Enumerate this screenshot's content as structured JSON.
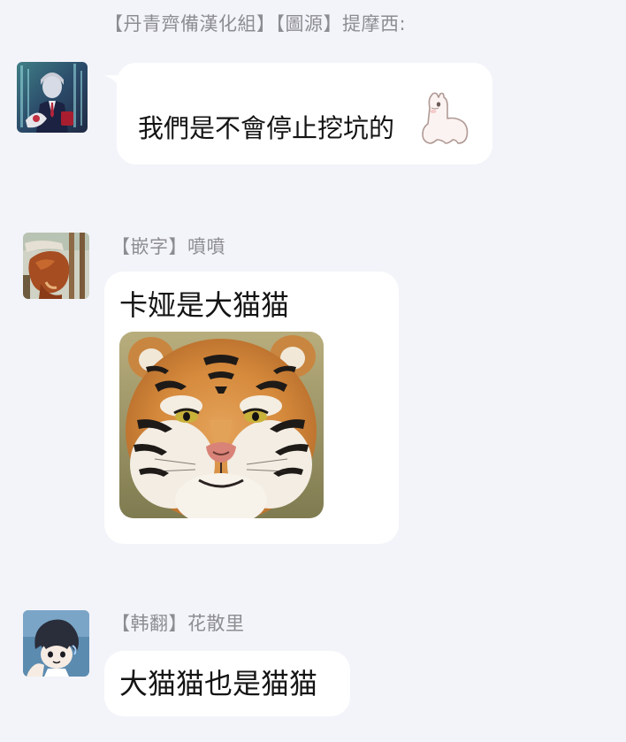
{
  "chat": {
    "messages": [
      {
        "sender": "【丹青齊備漢化組】【圖源】提摩西:",
        "text": "我們是不會停止挖坑的",
        "sticker_icon": "alpaca-sticker-icon"
      },
      {
        "sender": "【嵌字】噴噴",
        "text": "卡娅是大猫猫",
        "image_icon": "tiger-photo"
      },
      {
        "sender": "【韩翻】花散里",
        "text": "大猫猫也是猫猫"
      }
    ]
  },
  "colors": {
    "background": "#f3f4f9",
    "bubble": "#ffffff",
    "sender_name": "#8c8d92",
    "message_text": "#141414"
  }
}
